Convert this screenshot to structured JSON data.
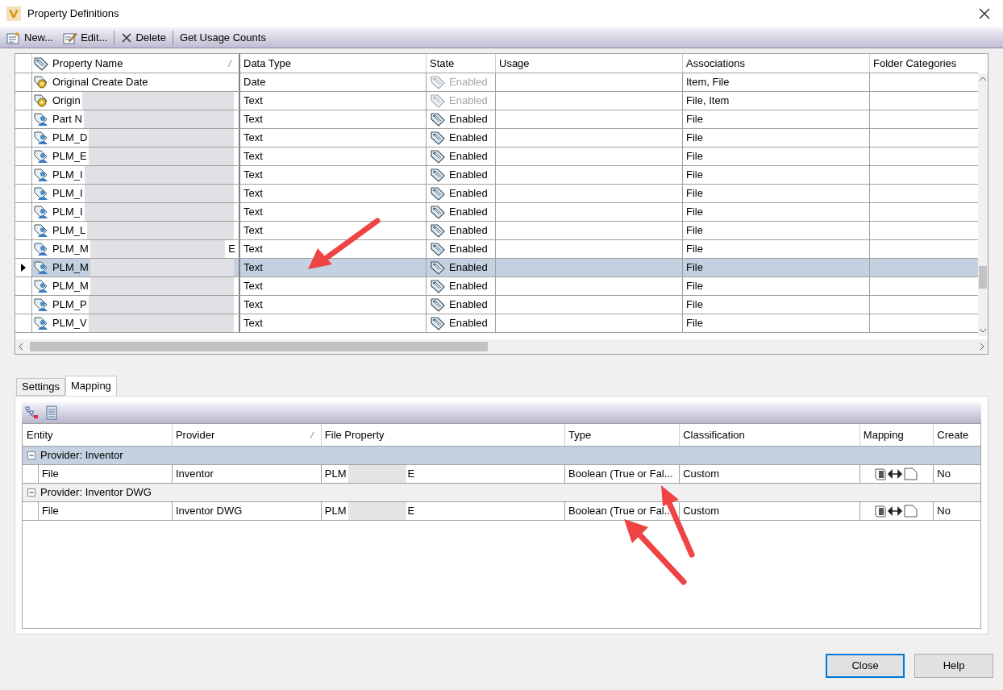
{
  "window": {
    "title": "Property Definitions"
  },
  "toolbar": [
    {
      "kind": "new",
      "label": "New..."
    },
    {
      "kind": "edit",
      "label": "Edit..."
    },
    {
      "kind": "delete",
      "label": "Delete"
    },
    {
      "kind": "plain",
      "label": "Get Usage Counts"
    }
  ],
  "properties": {
    "columns": [
      "Property Name",
      "Data Type",
      "State",
      "Usage",
      "Associations",
      "Folder Categories"
    ],
    "rows": [
      {
        "kind": "system",
        "name": "Original Create Date",
        "redacted": false,
        "name_tail": "",
        "data_type": "Date",
        "state": "Enabled",
        "disabled": true,
        "associations": "Item, File",
        "selected": false
      },
      {
        "kind": "system",
        "name": "Origin",
        "name_tail": "",
        "data_type": "Text",
        "state": "Enabled",
        "disabled": true,
        "associations": "File, Item",
        "selected": false
      },
      {
        "kind": "user",
        "name": "Part N",
        "name_tail": "",
        "data_type": "Text",
        "state": "Enabled",
        "disabled": false,
        "associations": "File",
        "selected": false
      },
      {
        "kind": "user",
        "name": "PLM_D",
        "name_tail": "",
        "data_type": "Text",
        "state": "Enabled",
        "disabled": false,
        "associations": "File",
        "selected": false
      },
      {
        "kind": "user",
        "name": "PLM_E",
        "name_tail": "",
        "data_type": "Text",
        "state": "Enabled",
        "disabled": false,
        "associations": "File",
        "selected": false
      },
      {
        "kind": "user",
        "name": "PLM_I",
        "name_tail": "",
        "data_type": "Text",
        "state": "Enabled",
        "disabled": false,
        "associations": "File",
        "selected": false
      },
      {
        "kind": "user",
        "name": "PLM_I",
        "name_tail": "",
        "data_type": "Text",
        "state": "Enabled",
        "disabled": false,
        "associations": "File",
        "selected": false
      },
      {
        "kind": "user",
        "name": "PLM_I",
        "name_tail": "",
        "data_type": "Text",
        "state": "Enabled",
        "disabled": false,
        "associations": "File",
        "selected": false
      },
      {
        "kind": "user",
        "name": "PLM_L",
        "name_tail": "",
        "data_type": "Text",
        "state": "Enabled",
        "disabled": false,
        "associations": "File",
        "selected": false
      },
      {
        "kind": "user",
        "name": "PLM_M",
        "name_tail": "E",
        "data_type": "Text",
        "state": "Enabled",
        "disabled": false,
        "associations": "File",
        "selected": false
      },
      {
        "kind": "user",
        "name": "PLM_M",
        "name_tail": "",
        "data_type": "Text",
        "state": "Enabled",
        "disabled": false,
        "associations": "File",
        "selected": true
      },
      {
        "kind": "user",
        "name": "PLM_M",
        "name_tail": "",
        "data_type": "Text",
        "state": "Enabled",
        "disabled": false,
        "associations": "File",
        "selected": false
      },
      {
        "kind": "user",
        "name": "PLM_P",
        "name_tail": "",
        "data_type": "Text",
        "state": "Enabled",
        "disabled": false,
        "associations": "File",
        "selected": false
      },
      {
        "kind": "user",
        "name": "PLM_V",
        "name_tail": "",
        "data_type": "Text",
        "state": "Enabled",
        "disabled": false,
        "associations": "File",
        "selected": false
      }
    ]
  },
  "tabs": [
    {
      "label": "Settings",
      "selected": false
    },
    {
      "label": "Mapping",
      "selected": true
    }
  ],
  "mapping": {
    "columns": [
      "Entity",
      "Provider",
      "File Property",
      "Type",
      "Classification",
      "Mapping",
      "Create"
    ],
    "groups": [
      {
        "label": "Provider: Inventor",
        "expanded": true,
        "selected": true,
        "rows": [
          {
            "entity": "File",
            "provider": "Inventor",
            "file_property": "PLM",
            "file_property_tail": "E",
            "type": "Boolean (True or Fal...",
            "classification": "Custom",
            "create": "No"
          }
        ]
      },
      {
        "label": "Provider: Inventor DWG",
        "expanded": true,
        "selected": false,
        "rows": [
          {
            "entity": "File",
            "provider": "Inventor DWG",
            "file_property": "PLM",
            "file_property_tail": "E",
            "type": "Boolean (True or Fal...",
            "classification": "Custom",
            "create": "No"
          }
        ]
      }
    ]
  },
  "buttons": [
    {
      "label": "Close",
      "default": true
    },
    {
      "label": "Help",
      "default": false
    }
  ]
}
